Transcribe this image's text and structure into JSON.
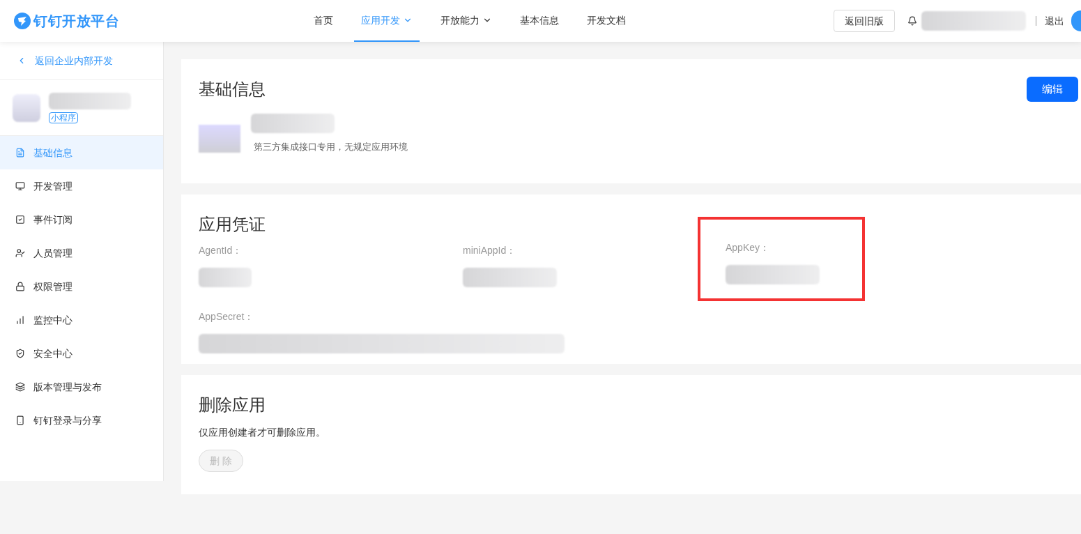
{
  "header": {
    "logo": "钉钉开放平台",
    "nav": [
      {
        "label": "首页",
        "selected": false,
        "dropdown": false
      },
      {
        "label": "应用开发",
        "selected": true,
        "dropdown": true
      },
      {
        "label": "开放能力",
        "selected": false,
        "dropdown": true
      },
      {
        "label": "基本信息",
        "selected": false,
        "dropdown": false
      },
      {
        "label": "开发文档",
        "selected": false,
        "dropdown": false
      }
    ],
    "old_version_button": "返回旧版",
    "logout": "退出"
  },
  "sidebar": {
    "back_link": "返回企业内部开发",
    "app_tag": "小程序",
    "items": [
      {
        "label": "基础信息",
        "selected": true
      },
      {
        "label": "开发管理",
        "selected": false
      },
      {
        "label": "事件订阅",
        "selected": false
      },
      {
        "label": "人员管理",
        "selected": false
      },
      {
        "label": "权限管理",
        "selected": false
      },
      {
        "label": "监控中心",
        "selected": false
      },
      {
        "label": "安全中心",
        "selected": false
      },
      {
        "label": "版本管理与发布",
        "selected": false
      },
      {
        "label": "钉钉登录与分享",
        "selected": false
      }
    ]
  },
  "basic_info": {
    "title": "基础信息",
    "edit_button": "编辑",
    "description": "第三方集成接口专用，无规定应用环境"
  },
  "credentials": {
    "title": "应用凭证",
    "fields": [
      {
        "label": "AgentId：",
        "highlighted": false
      },
      {
        "label": "miniAppId：",
        "highlighted": false
      },
      {
        "label": "AppKey：",
        "highlighted": true
      },
      {
        "label": "AppSecret：",
        "highlighted": false
      }
    ]
  },
  "delete_app": {
    "title": "删除应用",
    "note": "仅应用创建者才可删除应用。",
    "button": "删 除",
    "button_disabled": true
  }
}
